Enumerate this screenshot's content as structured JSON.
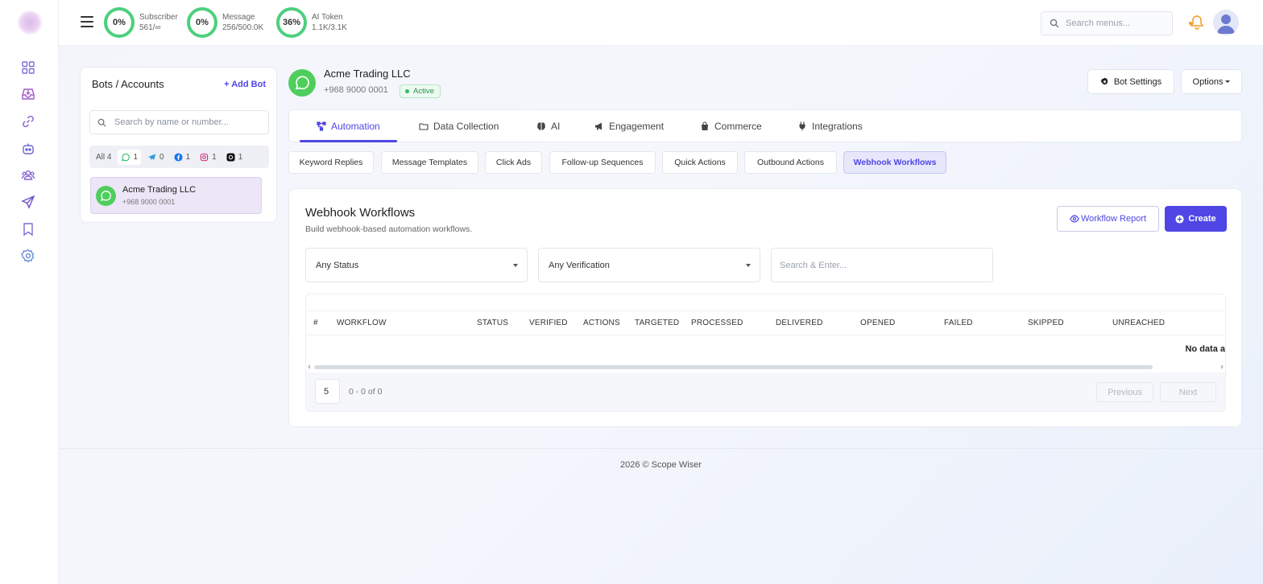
{
  "sidebar": {
    "items": [
      {
        "icon": "dashboard-icon"
      },
      {
        "icon": "inbox-icon"
      },
      {
        "icon": "link-icon"
      },
      {
        "icon": "bot-icon"
      },
      {
        "icon": "users-icon"
      },
      {
        "icon": "send-icon"
      },
      {
        "icon": "bookmark-icon"
      },
      {
        "icon": "settings-icon"
      }
    ]
  },
  "topbar": {
    "stats": [
      {
        "percent": "0%",
        "label": "Subscriber",
        "value": "561/∞"
      },
      {
        "percent": "0%",
        "label": "Message",
        "value": "256/500.0K"
      },
      {
        "percent": "36%",
        "label": "AI Token",
        "value": "1.1K/3.1K"
      }
    ],
    "search_placeholder": "Search menus..."
  },
  "bots": {
    "title": "Bots / Accounts",
    "add_label": "+ Add Bot",
    "search_placeholder": "Search by name or number...",
    "filters": [
      {
        "label": "All 4",
        "icon": ""
      },
      {
        "label": "1",
        "icon": "whatsapp-icon"
      },
      {
        "label": "0",
        "icon": "telegram-icon"
      },
      {
        "label": "1",
        "icon": "facebook-icon"
      },
      {
        "label": "1",
        "icon": "instagram-icon"
      },
      {
        "label": "1",
        "icon": "threads-icon"
      }
    ],
    "items": [
      {
        "name": "Acme Trading LLC",
        "number": "+968 9000 0001"
      }
    ]
  },
  "account": {
    "name": "Acme Trading LLC",
    "number": "+968 9000 0001",
    "status": "Active",
    "bot_settings_label": "Bot Settings",
    "options_label": "Options"
  },
  "tabs": [
    {
      "label": "Automation",
      "icon": "flow-icon"
    },
    {
      "label": "Data Collection",
      "icon": "folder-icon"
    },
    {
      "label": "AI",
      "icon": "brain-icon"
    },
    {
      "label": "Engagement",
      "icon": "megaphone-icon"
    },
    {
      "label": "Commerce",
      "icon": "bag-icon"
    },
    {
      "label": "Integrations",
      "icon": "plug-icon"
    }
  ],
  "subtabs": [
    "Keyword Replies",
    "Message Templates",
    "Click Ads",
    "Follow-up Sequences",
    "Quick Actions",
    "Outbound Actions",
    "Webhook Workflows"
  ],
  "card": {
    "title": "Webhook Workflows",
    "subtitle": "Build webhook-based automation workflows.",
    "report_label": "Workflow Report",
    "create_label": "Create",
    "status_select": "Any Status",
    "verification_select": "Any Verification",
    "search_placeholder": "Search & Enter...",
    "columns": [
      "#",
      "WORKFLOW",
      "STATUS",
      "VERIFIED",
      "ACTIONS",
      "TARGETED",
      "PROCESSED",
      "DELIVERED",
      "OPENED",
      "FAILED",
      "SKIPPED",
      "UNREACHED"
    ],
    "empty_text": "No data a",
    "page_size": "5",
    "page_info": "0 - 0 of 0",
    "prev_label": "Previous",
    "next_label": "Next"
  },
  "footer": "2026 © Scope Wiser",
  "colors": {
    "accent": "#4f46e5",
    "ring": "#4cd07d",
    "whatsapp": "#4fce5d"
  }
}
